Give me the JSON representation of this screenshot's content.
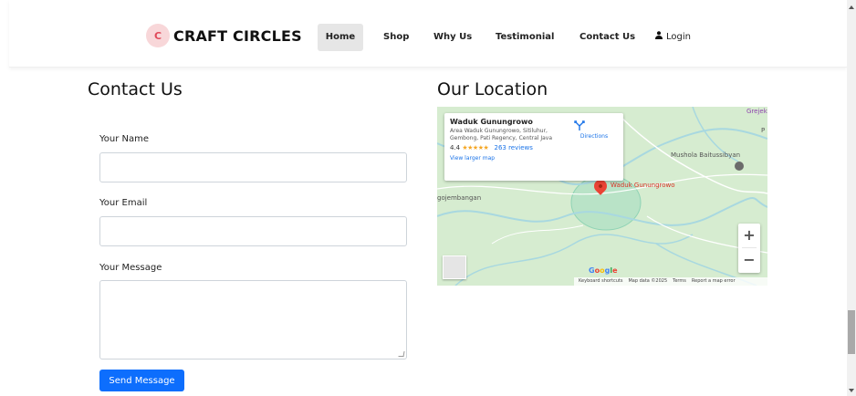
{
  "navbar": {
    "brand": "CRAFT CIRCLES",
    "logo_letter": "C",
    "items": [
      "Home",
      "Shop",
      "Why Us",
      "Testimonial",
      "Contact Us"
    ],
    "login": "Login",
    "active_index": 0
  },
  "contact": {
    "title": "Contact Us",
    "name_label": "Your Name",
    "email_label": "Your Email",
    "message_label": "Your Message",
    "name_value": "",
    "email_value": "",
    "message_value": "",
    "submit_label": "Send Message"
  },
  "location": {
    "title": "Our Location",
    "card": {
      "title": "Waduk Gunungrowo",
      "address": "Area Waduk Gunungrowo, Sitiluhur, Gembong, Pati Regency, Central Java",
      "rating": "4.4",
      "stars": "★★★★★",
      "reviews": "263 reviews",
      "view_larger": "View larger map",
      "directions": "Directions"
    },
    "labels": {
      "grejekan": "Grejekan",
      "mushola": "Mushola Baitussibyan",
      "gojembangan": "gojembangan",
      "waduk": "Waduk Gunungrowo",
      "p": "P"
    },
    "zoom_in": "+",
    "zoom_out": "−",
    "google": {
      "g1": "G",
      "g2": "o",
      "g3": "o",
      "g4": "g",
      "g5": "l",
      "g6": "e"
    },
    "attribution": [
      "Keyboard shortcuts",
      "Map data ©2025",
      "Terms",
      "Report a map error"
    ]
  },
  "colors": {
    "primary_button": "#0d6efd",
    "active_nav_bg": "#e6e6e6",
    "map_bg": "#cfe9c9",
    "pin": "#ea4335",
    "link": "#1a73e8"
  }
}
